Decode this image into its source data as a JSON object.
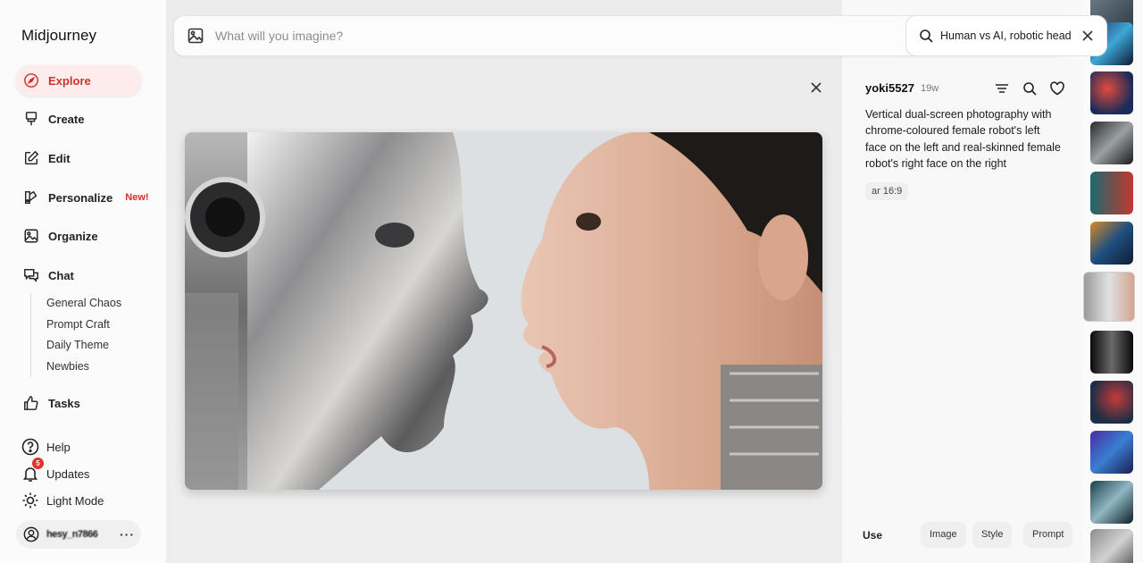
{
  "app": {
    "title": "Midjourney"
  },
  "sidebar": {
    "items": [
      {
        "label": "Explore",
        "icon": "compass-icon",
        "active": true
      },
      {
        "label": "Create",
        "icon": "paintbrush-icon"
      },
      {
        "label": "Edit",
        "icon": "pencil-square-icon"
      },
      {
        "label": "Personalize",
        "icon": "palette-icon",
        "badge": "New!"
      },
      {
        "label": "Organize",
        "icon": "image-icon"
      },
      {
        "label": "Chat",
        "icon": "chat-bubbles-icon"
      }
    ],
    "chat_channels": [
      "General Chaos",
      "Prompt Craft",
      "Daily Theme",
      "Newbies"
    ],
    "tasks_label": "Tasks",
    "help_label": "Help",
    "updates_label": "Updates",
    "updates_count": "5",
    "light_mode_label": "Light Mode",
    "user": {
      "name": "hesy_n7866",
      "menu_glyph": "···"
    }
  },
  "prompt": {
    "placeholder": "What will you imagine?"
  },
  "search": {
    "query": "Human vs AI, robotic head"
  },
  "detail": {
    "author": "yoki5527",
    "age": "19w",
    "description": "Vertical dual-screen photography with chrome-coloured female robot's left face on the left and real-skinned female robot's right face on the right",
    "aspect_tag": "ar 16:9",
    "use_label": "Use",
    "use_buttons": [
      "Image",
      "Style",
      "Prompt"
    ]
  },
  "colors": {
    "accent": "#d2322d",
    "accent_bg": "#fdeceb"
  }
}
